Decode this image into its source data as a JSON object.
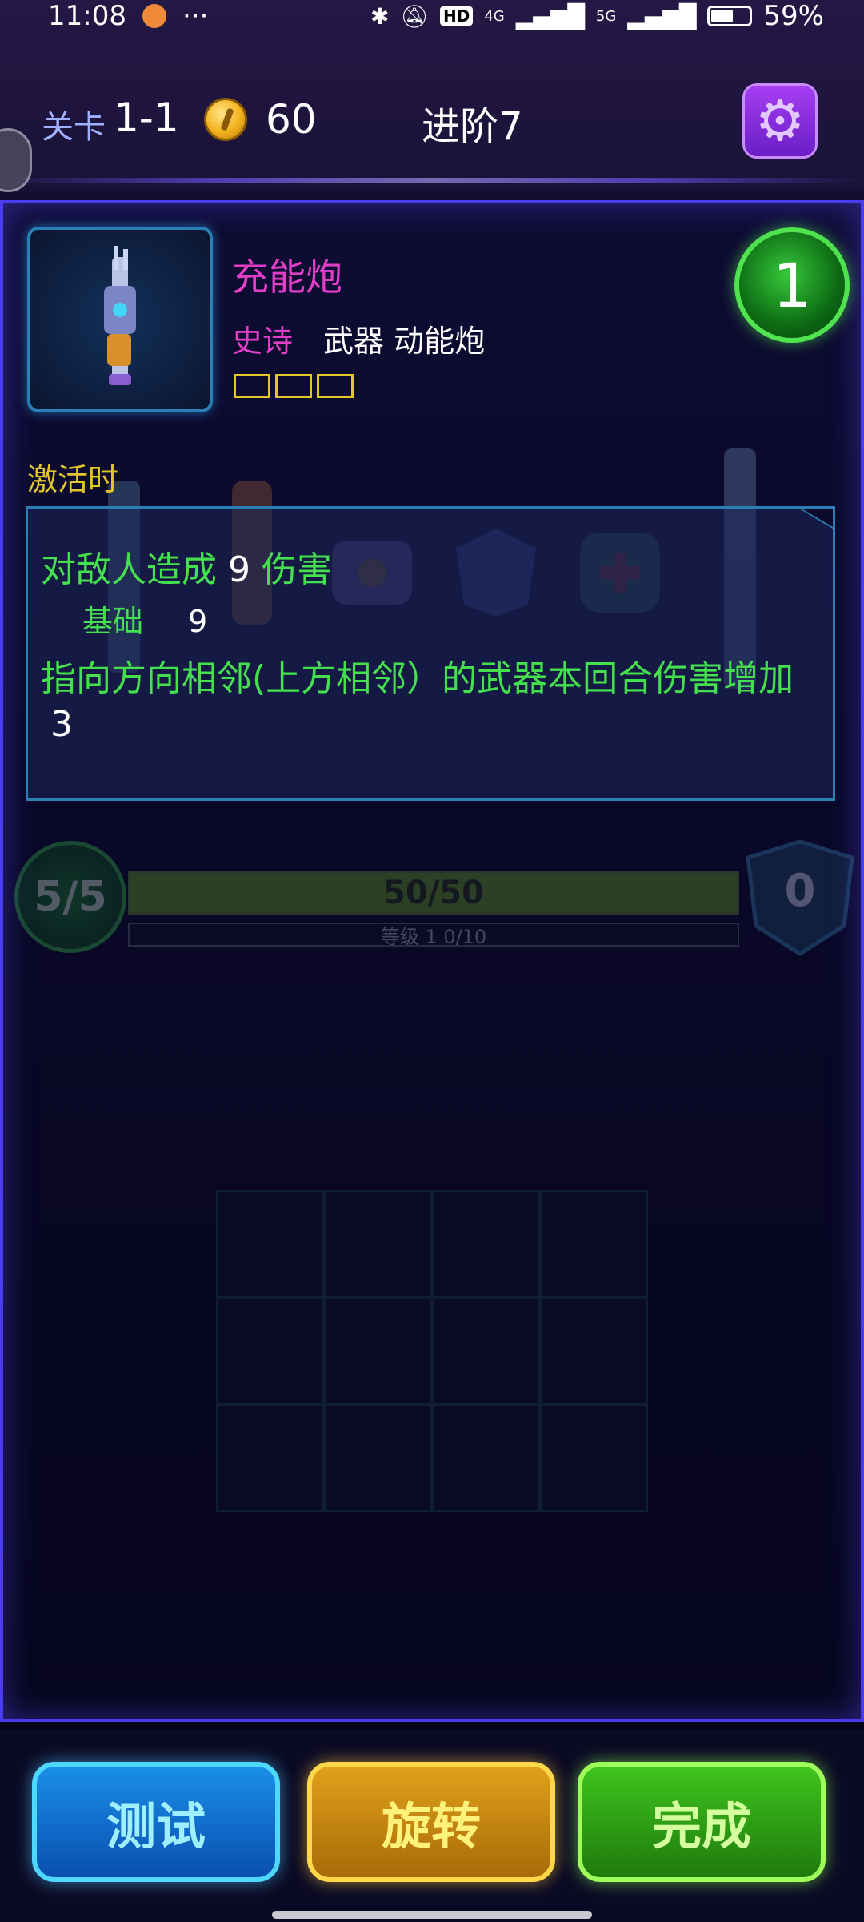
{
  "status_bar": {
    "time": "11:08",
    "more": "···",
    "battery": "59%",
    "battery_level": 0.59,
    "network_hd": "HD",
    "network_4g": "4G",
    "network_5g": "5G"
  },
  "top_bar": {
    "level_label": "关卡",
    "level_value": "1-1",
    "coins": "60",
    "stage": "进阶7",
    "settings_icon": "gear-icon"
  },
  "card": {
    "name": "充能炮",
    "rarity": "史诗",
    "type": "武器 动能炮",
    "slots": 3,
    "cost": "1",
    "trigger_label": "激活时",
    "desc": {
      "line1_text": "对敌人造成",
      "line1_num": "9",
      "line1_suffix": "伤害",
      "line2_text": "基础",
      "line2_num": "9",
      "line3_text": "指向方向相邻(上方相邻）的武器本回合伤害增加",
      "line4_num": "3"
    }
  },
  "status": {
    "hp_count": "5/5",
    "hp_bar": "50/50",
    "hp_fraction": 1.0,
    "level_text": "等级 1  0/10",
    "shield": "0"
  },
  "buttons": {
    "test": "测试",
    "rotate": "旋转",
    "done": "完成"
  },
  "colors": {
    "rarity_epic": "#e33ec9",
    "effect_green": "#45e04d",
    "trigger_yellow": "#e3c72a",
    "panel_border": "#4b3cf0"
  }
}
